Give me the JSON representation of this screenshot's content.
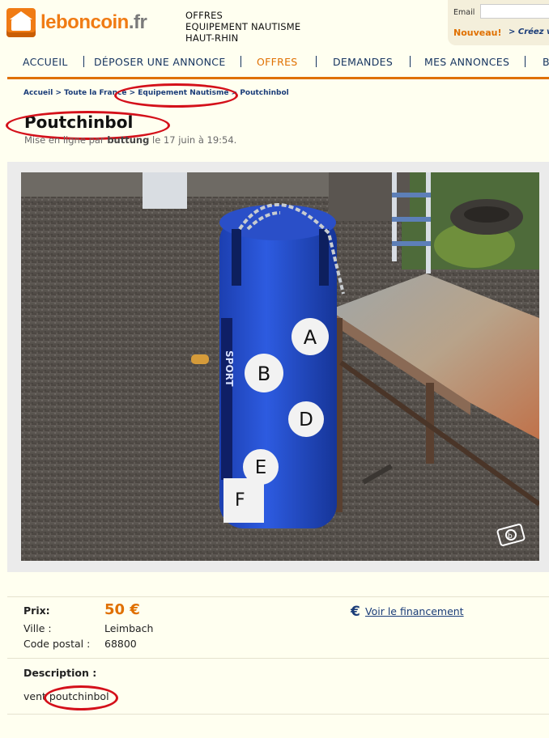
{
  "header": {
    "logo_main": "leboncoin",
    "logo_tld": ".fr",
    "section_lines": [
      "OFFRES",
      "EQUIPEMENT NAUTISME",
      "HAUT-RHIN"
    ],
    "email_label": "Email",
    "nouveau_label": "Nouveau!",
    "creez_text": "> Créez v"
  },
  "nav": {
    "items": [
      "ACCUEIL",
      "DÉPOSER UNE ANNONCE",
      "OFFRES",
      "DEMANDES",
      "MES ANNONCES",
      "B"
    ],
    "active": "OFFRES",
    "accent_color": "#e07000",
    "link_color": "#15335f"
  },
  "breadcrumb": {
    "items": [
      "Accueil",
      "Toute la France",
      "Equipement Nautisme",
      "Poutchinbol"
    ],
    "separator": ">"
  },
  "ad": {
    "title": "Poutchinbol",
    "posted_prefix": "Mise en ligne par",
    "posted_user": "buttung",
    "posted_suffix": "le 17 juin à 19:54."
  },
  "photo": {
    "bag_letters": [
      "A",
      "B",
      "D",
      "E",
      "F"
    ],
    "bag_side_text": "SPORT",
    "camera_icon": "camera-icon"
  },
  "details": {
    "price_label": "Prix:",
    "price_value": "50 €",
    "city_label": "Ville :",
    "city_value": "Leimbach",
    "postal_label": "Code postal :",
    "postal_value": "68800",
    "finance_link": "Voir le financement",
    "description_label": "Description :",
    "description_text_prefix": "vent",
    "description_text_highlight": "poutchinbol"
  },
  "annotation_color": "#d4101a"
}
